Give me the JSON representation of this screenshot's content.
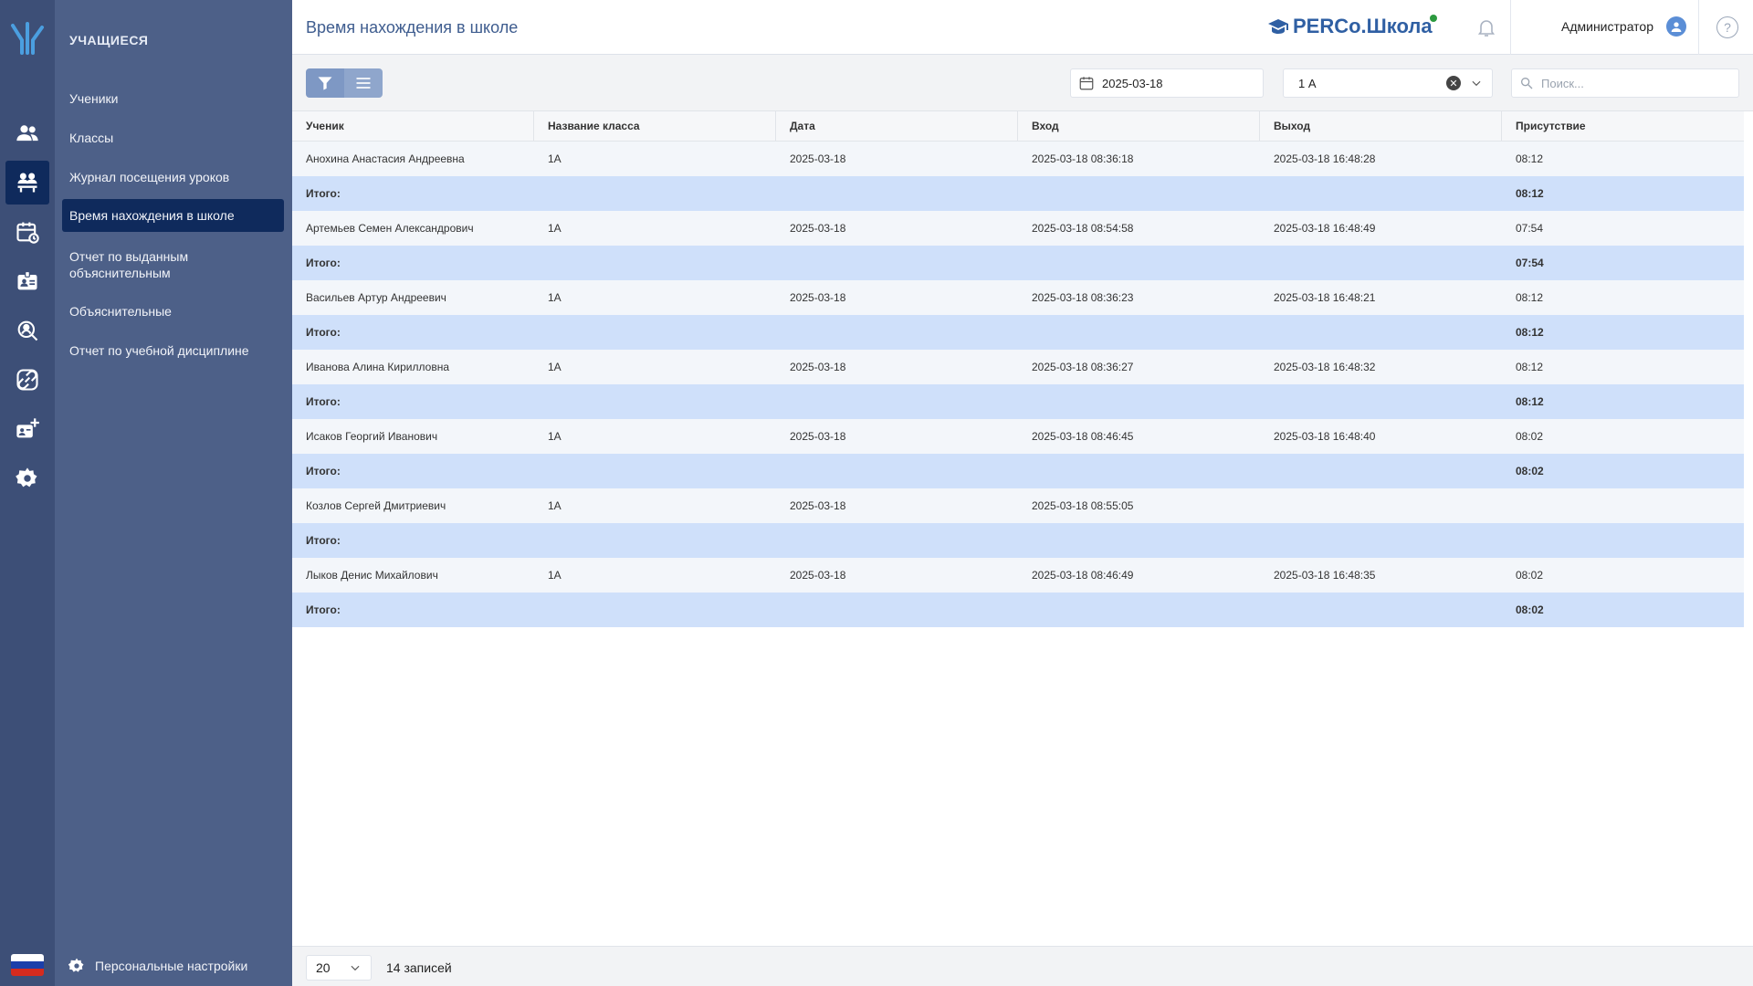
{
  "sidebar": {
    "title": "УЧАЩИЕСЯ",
    "items": [
      {
        "label": "Ученики"
      },
      {
        "label": "Классы"
      },
      {
        "label": "Журнал посещения уроков"
      },
      {
        "label": "Время нахождения в школе"
      },
      {
        "label": "Отчет по выданным объяснительным"
      },
      {
        "label": "Объяснительные"
      },
      {
        "label": "Отчет по учебной дисциплине"
      }
    ],
    "active_index": 3,
    "footer_label": "Персональные настройки"
  },
  "rail_icons": [
    "staff-icon",
    "students-icon",
    "schedule-icon",
    "badge-icon",
    "visitor-search-icon",
    "access-icon",
    "add-card-icon",
    "settings-icon"
  ],
  "header": {
    "title": "Время нахождения в школе",
    "brand": "PERCo.Школа",
    "user": "Администратор",
    "help": "?"
  },
  "toolbar": {
    "date": "2025-03-18",
    "class_value": "1 А",
    "search_placeholder": "Поиск..."
  },
  "table": {
    "columns": [
      "Ученик",
      "Название класса",
      "Дата",
      "Вход",
      "Выход",
      "Присутствие"
    ],
    "rows": [
      {
        "type": "data",
        "cells": [
          "Анохина Анастасия Андреевна",
          "1А",
          "2025-03-18",
          "2025-03-18 08:36:18",
          "2025-03-18 16:48:28",
          "08:12"
        ]
      },
      {
        "type": "total",
        "cells": [
          "Итого:",
          "",
          "",
          "",
          "",
          "08:12"
        ]
      },
      {
        "type": "data",
        "cells": [
          "Артемьев Семен Александрович",
          "1А",
          "2025-03-18",
          "2025-03-18 08:54:58",
          "2025-03-18 16:48:49",
          "07:54"
        ]
      },
      {
        "type": "total",
        "cells": [
          "Итого:",
          "",
          "",
          "",
          "",
          "07:54"
        ]
      },
      {
        "type": "data",
        "cells": [
          "Васильев Артур Андреевич",
          "1А",
          "2025-03-18",
          "2025-03-18 08:36:23",
          "2025-03-18 16:48:21",
          "08:12"
        ]
      },
      {
        "type": "total",
        "cells": [
          "Итого:",
          "",
          "",
          "",
          "",
          "08:12"
        ]
      },
      {
        "type": "data",
        "cells": [
          "Иванова Алина Кирилловна",
          "1А",
          "2025-03-18",
          "2025-03-18 08:36:27",
          "2025-03-18 16:48:32",
          "08:12"
        ]
      },
      {
        "type": "total",
        "cells": [
          "Итого:",
          "",
          "",
          "",
          "",
          "08:12"
        ]
      },
      {
        "type": "data",
        "cells": [
          "Исаков Георгий Иванович",
          "1А",
          "2025-03-18",
          "2025-03-18 08:46:45",
          "2025-03-18 16:48:40",
          "08:02"
        ]
      },
      {
        "type": "total",
        "cells": [
          "Итого:",
          "",
          "",
          "",
          "",
          "08:02"
        ]
      },
      {
        "type": "data",
        "cells": [
          "Козлов Сергей Дмитриевич",
          "1А",
          "2025-03-18",
          "2025-03-18 08:55:05",
          "",
          ""
        ]
      },
      {
        "type": "total",
        "cells": [
          "Итого:",
          "",
          "",
          "",
          "",
          ""
        ]
      },
      {
        "type": "data",
        "cells": [
          "Лыков Денис Михайлович",
          "1А",
          "2025-03-18",
          "2025-03-18 08:46:49",
          "2025-03-18 16:48:35",
          "08:02"
        ]
      },
      {
        "type": "total",
        "cells": [
          "Итого:",
          "",
          "",
          "",
          "",
          "08:02"
        ]
      }
    ]
  },
  "footer": {
    "page_size": "20",
    "count": "14 записей"
  },
  "colors": {
    "rail_bg": "#3d4f77",
    "sidebar_bg": "#4d6088",
    "active_item": "#0f2a5c",
    "total_row": "#cfe0fa",
    "brand": "#2f5fa3"
  }
}
